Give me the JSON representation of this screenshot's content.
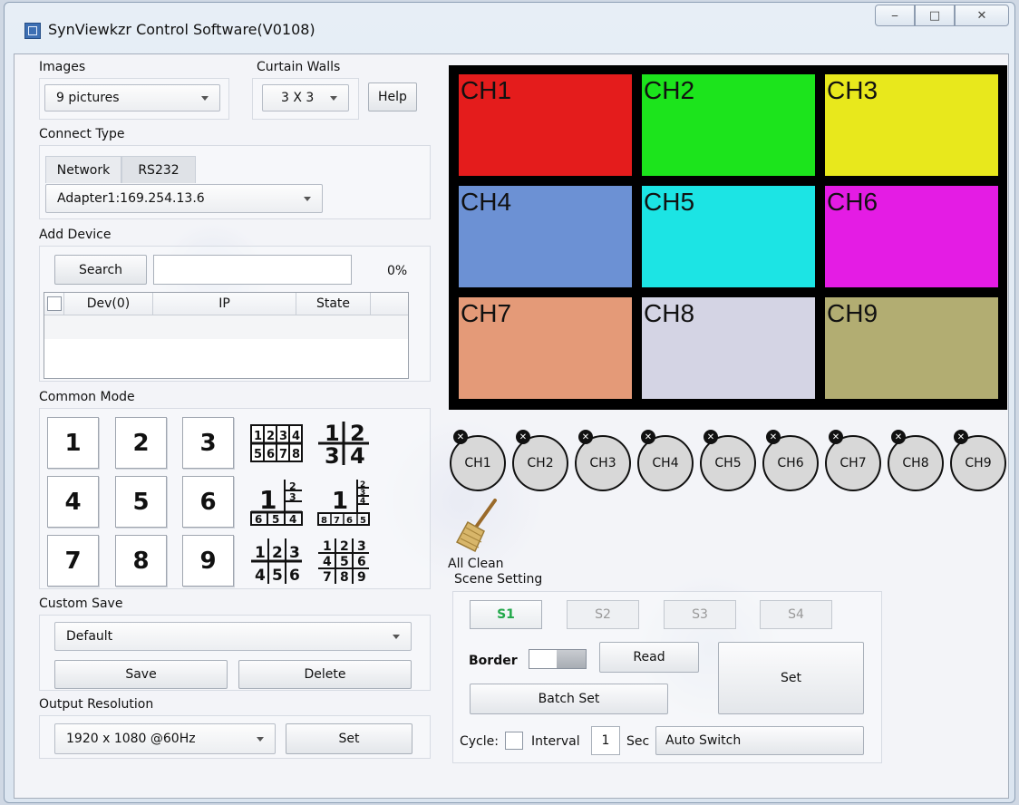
{
  "window": {
    "title": "SynViewkzr Control Software(V0108)"
  },
  "left": {
    "images_label": "Images",
    "images_value": "9 pictures",
    "curtain_walls_label": "Curtain Walls",
    "curtain_walls_value": "3 X 3",
    "help_label": "Help",
    "connect_type_label": "Connect Type",
    "tabs": [
      "Network",
      "RS232"
    ],
    "adapter_value": "Adapter1:169.254.13.6",
    "add_device_label": "Add Device",
    "search_label": "Search",
    "search_progress": "0%",
    "device_table": {
      "headers": [
        "Dev(0)",
        "IP",
        "State"
      ],
      "rows": []
    },
    "common_mode_label": "Common Mode",
    "mode_numbers": [
      "1",
      "2",
      "3",
      "4",
      "5",
      "6",
      "7",
      "8",
      "9"
    ],
    "custom_save_label": "Custom Save",
    "custom_save_value": "Default",
    "save_label": "Save",
    "delete_label": "Delete",
    "output_resolution_label": "Output Resolution",
    "resolution_value": "1920 x 1080 @60Hz",
    "set_label": "Set"
  },
  "wall": {
    "cells": [
      {
        "label": "CH1",
        "color": "#e41c1c"
      },
      {
        "label": "CH2",
        "color": "#1ce41c"
      },
      {
        "label": "CH3",
        "color": "#e8e81c"
      },
      {
        "label": "CH4",
        "color": "#6c91d4"
      },
      {
        "label": "CH5",
        "color": "#1ce4e4"
      },
      {
        "label": "CH6",
        "color": "#e41ce4"
      },
      {
        "label": "CH7",
        "color": "#e49a78"
      },
      {
        "label": "CH8",
        "color": "#d4d4e4"
      },
      {
        "label": "CH9",
        "color": "#b2ad72"
      }
    ]
  },
  "channels": [
    "CH1",
    "CH2",
    "CH3",
    "CH4",
    "CH5",
    "CH6",
    "CH7",
    "CH8",
    "CH9"
  ],
  "right": {
    "all_clean_label": "All Clean",
    "scene_setting_label": "Scene Setting",
    "scenes": [
      "S1",
      "S2",
      "S3",
      "S4"
    ],
    "border_label": "Border",
    "read_label": "Read",
    "set_label": "Set",
    "batch_set_label": "Batch Set",
    "cycle_label": "Cycle:",
    "interval_label": "Interval",
    "interval_value": "1",
    "sec_label": "Sec",
    "auto_switch_label": "Auto Switch"
  }
}
